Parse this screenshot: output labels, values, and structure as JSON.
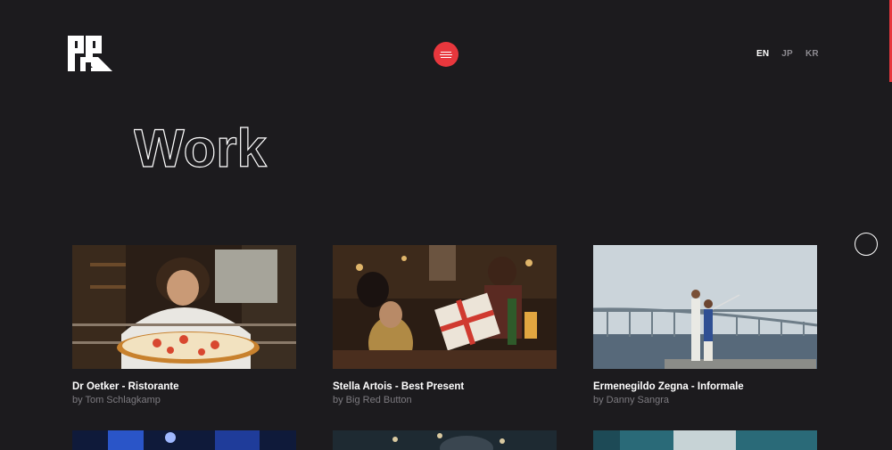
{
  "header": {
    "menu_label": "Menu",
    "languages": [
      {
        "code": "EN",
        "active": true
      },
      {
        "code": "JP",
        "active": false
      },
      {
        "code": "KR",
        "active": false
      }
    ]
  },
  "page": {
    "title": "Work"
  },
  "colors": {
    "background": "#1c1b1e",
    "accent": "#e8373d",
    "muted_text": "#7d7b80"
  },
  "works": [
    {
      "title": "Dr Oetker - Ristorante",
      "credit": "by Tom Schlagkamp"
    },
    {
      "title": "Stella Artois - Best Present",
      "credit": "by Big Red Button"
    },
    {
      "title": "Ermenegildo Zegna - Informale",
      "credit": "by Danny Sangra"
    }
  ]
}
